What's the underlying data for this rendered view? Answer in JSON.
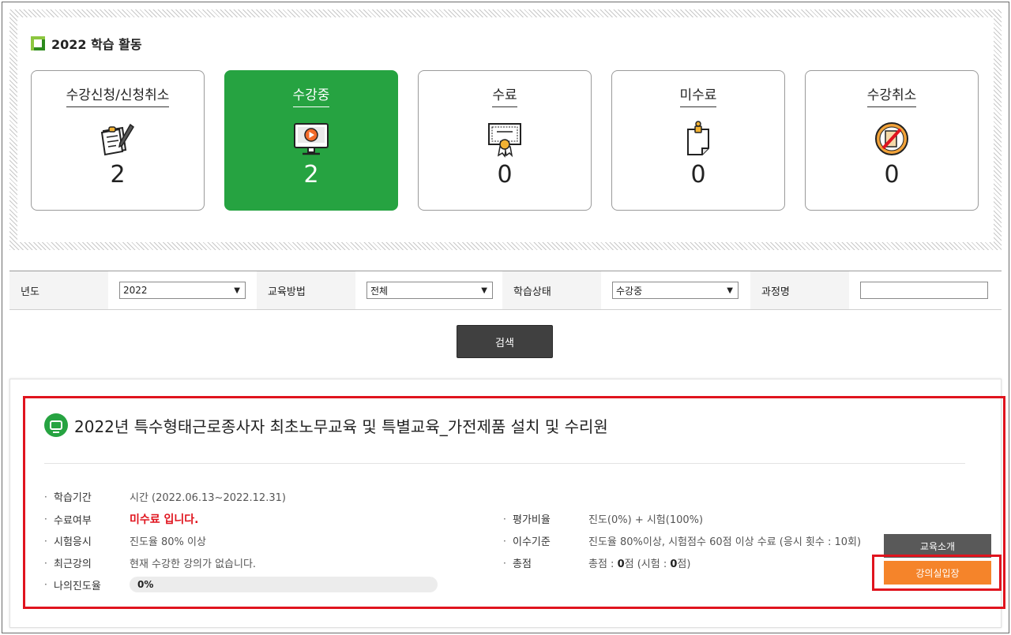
{
  "activity": {
    "title": "2022 학습 활동",
    "cards": [
      {
        "label": "수강신청/신청취소",
        "count": "2",
        "icon": "clipboard-pen-icon",
        "active": false
      },
      {
        "label": "수강중",
        "count": "2",
        "icon": "monitor-play-icon",
        "active": true
      },
      {
        "label": "수료",
        "count": "0",
        "icon": "certificate-icon",
        "active": false
      },
      {
        "label": "미수료",
        "count": "0",
        "icon": "pinned-note-icon",
        "active": false
      },
      {
        "label": "수강취소",
        "count": "0",
        "icon": "cancel-book-icon",
        "active": false
      }
    ]
  },
  "filter": {
    "year_label": "년도",
    "year_value": "2022",
    "method_label": "교육방법",
    "method_value": "전체",
    "status_label": "학습상태",
    "status_value": "수강중",
    "course_label": "과정명",
    "course_value": ""
  },
  "search_button": "검색",
  "course": {
    "title": "2022년 특수형태근로종사자 최초노무교육 및 특별교육_가전제품 설치 및 수리원",
    "period_label": "학습기간",
    "period_value": "시간 (2022.06.13~2022.12.31)",
    "completion_label": "수료여부",
    "completion_value": "미수료 입니다.",
    "exam_label": "시험응시",
    "exam_value": "진도율 80% 이상",
    "recent_label": "최근강의",
    "recent_value": "현재 수강한 강의가 없습니다.",
    "progress_label": "나의진도율",
    "progress_value": "0%",
    "progress_fraction": 0,
    "ratio_label": "평가비율",
    "ratio_value": "진도(0%) + 시험(100%)",
    "criteria_label": "이수기준",
    "criteria_value": "진도율 80%이상, 시험점수 60점 이상 수료 (응시 횟수 : 10회)",
    "total_label": "총점",
    "total_prefix": "총점 : ",
    "total_score": "0",
    "total_mid": "점 (시험 : ",
    "total_exam": "0",
    "total_suffix": "점)",
    "intro_button": "교육소개",
    "enter_button": "강의실입장"
  },
  "colors": {
    "accent_green": "#26a341",
    "highlight_red": "#e0141e",
    "enter_orange": "#f5842a",
    "dark_button": "#404040"
  }
}
